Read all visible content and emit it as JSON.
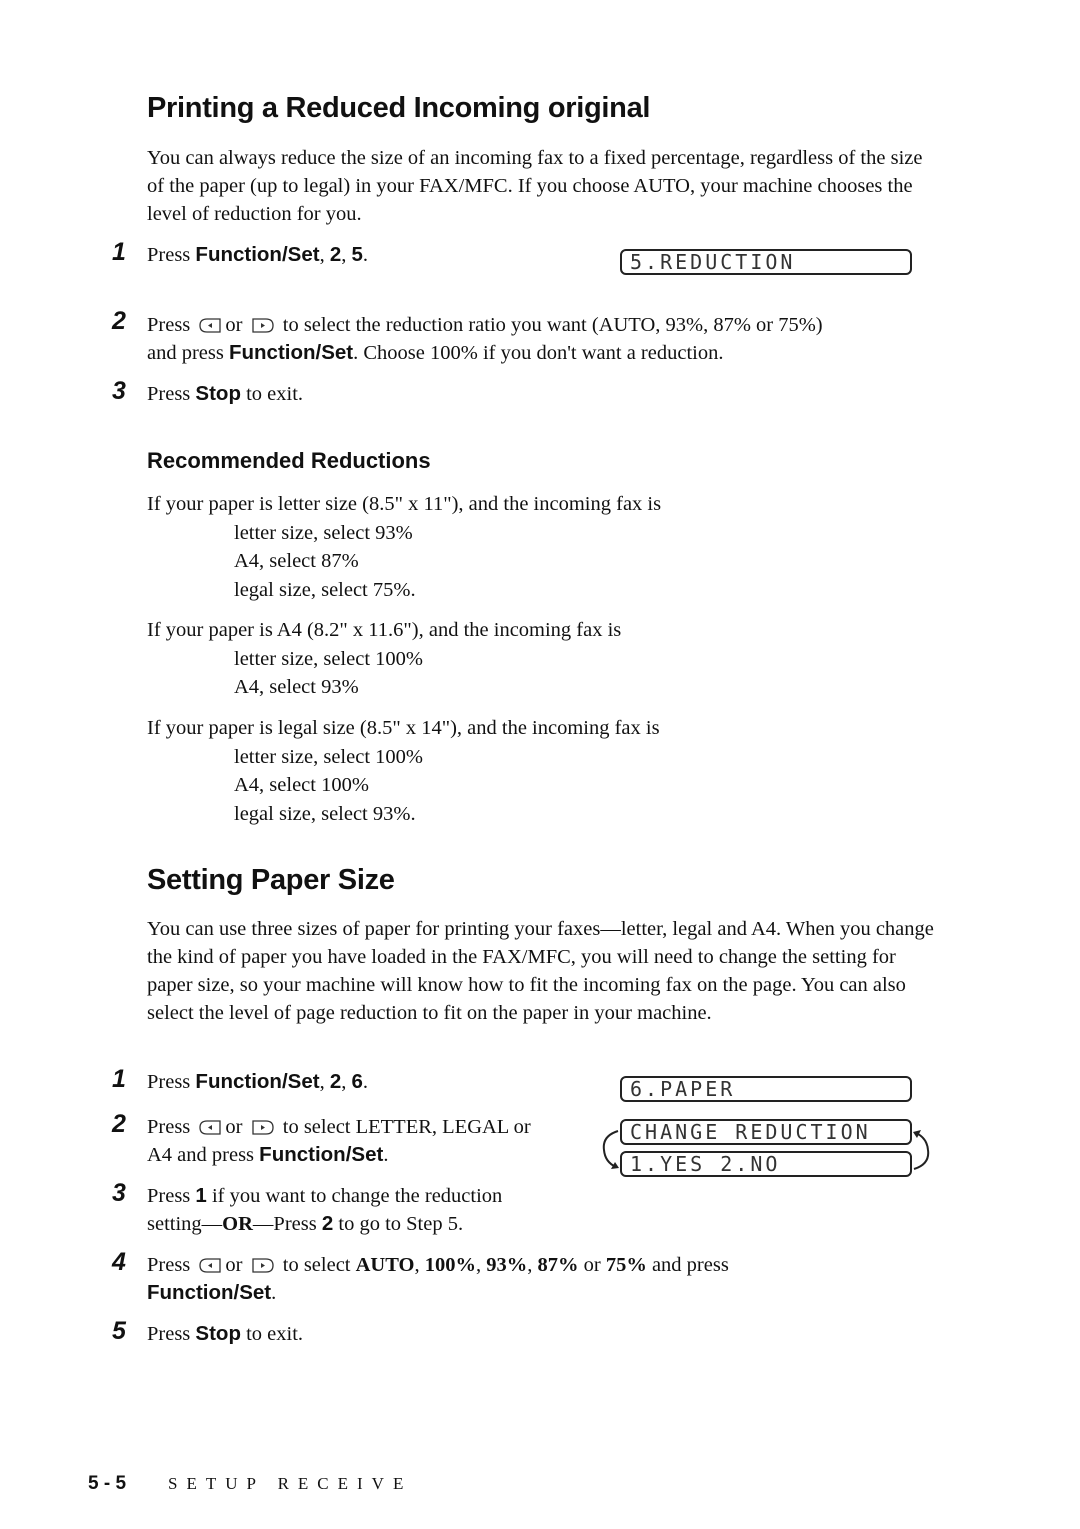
{
  "section1": {
    "title": "Printing a Reduced Incoming original",
    "intro": "You can always reduce the size of an incoming fax to a fixed percentage, regardless of the size of the paper (up to legal) in your FAX/MFC.  If you choose AUTO, your machine chooses the level of reduction for you.",
    "steps": [
      {
        "num": "1",
        "pre": "Press ",
        "bold": "Function/Set",
        "post": ", ",
        "b2": "2",
        "mid": ", ",
        "b3": "5",
        "end": "."
      },
      {
        "num": "2",
        "pre": "Press",
        "or": "or",
        "post": "to select the reduction ratio you want (AUTO, 93%, 87% or 75%)",
        "line2_pre": "and press ",
        "line2_bold": "Function/Set",
        "line2_post": ". Choose 100% if you don't want a reduction."
      },
      {
        "num": "3",
        "pre": "Press ",
        "bold": "Stop",
        "post": " to exit."
      }
    ],
    "lcd": "5.REDUCTION"
  },
  "recommended": {
    "title": "Recommended Reductions",
    "groups": [
      {
        "lead": "If your paper is letter size (8.5\" x 11\"), and the incoming fax is",
        "items": [
          "letter size, select 93%",
          "A4, select 87%",
          "legal size, select 75%."
        ]
      },
      {
        "lead": "If your paper is A4 (8.2\" x 11.6\"), and the incoming fax is",
        "items": [
          "letter size, select 100%",
          "A4, select 93%"
        ]
      },
      {
        "lead": "If your paper is legal size (8.5\" x 14\"), and the incoming fax is",
        "items": [
          "letter size, select 100%",
          "A4, select 100%",
          "legal size, select 93%."
        ]
      }
    ]
  },
  "section2": {
    "title": "Setting Paper Size",
    "intro": "You can use three sizes of paper for printing your faxes—letter, legal and A4.  When you change the kind of paper you have loaded in the FAX/MFC, you will need to change the setting for paper size, so your machine will know how to fit the incoming fax on the page.  You can also select the level of page reduction to fit on the paper in your machine.",
    "steps": [
      {
        "num": "1",
        "pre": "Press ",
        "bold": "Function/Set",
        "post": ", ",
        "b2": "2",
        "mid": ", ",
        "b3": "6",
        "end": "."
      },
      {
        "num": "2",
        "pre": "Press",
        "or": "or",
        "post": "to select LETTER, LEGAL or",
        "line2_pre": "A4 and press ",
        "line2_bold": "Function/Set",
        "line2_post": "."
      },
      {
        "num": "3",
        "pre": "Press ",
        "bold": "1",
        "post": " if you want to change the reduction",
        "line2_pre": "setting—",
        "line2_bold": "OR",
        "line2_mid": "—Press ",
        "line2_b2": "2",
        "line2_post": " to go to Step 5."
      },
      {
        "num": "4",
        "pre": "Press",
        "or": "or",
        "post": "to select ",
        "opts": [
          "AUTO",
          "100%",
          "93%",
          "87%",
          "75%"
        ],
        "sep1": ", ",
        "or2": " or ",
        "tail": " and press",
        "line2_bold": "Function/Set",
        "line2_post": "."
      },
      {
        "num": "5",
        "pre": "Press ",
        "bold": "Stop",
        "post": " to exit."
      }
    ],
    "lcd": [
      "6.PAPER",
      "CHANGE REDUCTION",
      "1.YES 2.NO"
    ]
  },
  "footer": {
    "page": "5 - 5",
    "chapter": "SETUP RECEIVE"
  }
}
